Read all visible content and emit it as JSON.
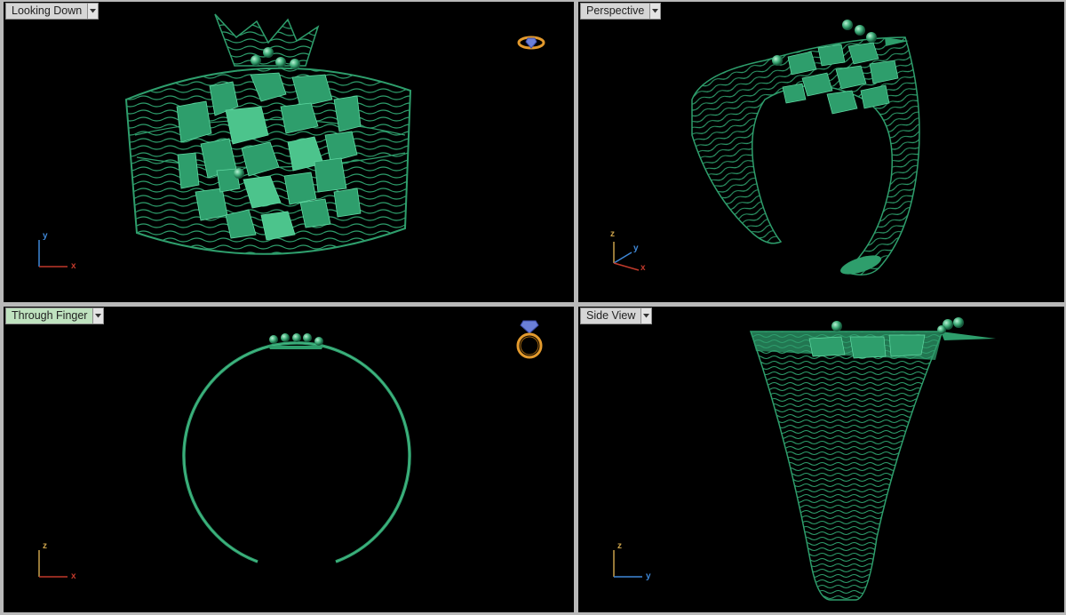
{
  "viewports": [
    {
      "id": "top-left",
      "label": "Looking Down",
      "active": false,
      "axis_v": "y",
      "axis_h": "x"
    },
    {
      "id": "top-right",
      "label": "Perspective",
      "active": false,
      "axis_v": "z",
      "axis_d": "y",
      "axis_h": "x"
    },
    {
      "id": "bottom-left",
      "label": "Through Finger",
      "active": true,
      "axis_v": "z",
      "axis_h": "x"
    },
    {
      "id": "bottom-right",
      "label": "Side View",
      "active": false,
      "axis_v": "z",
      "axis_h": "y"
    }
  ],
  "colors": {
    "model": "#2e9e6c",
    "model_light": "#5fd9a2",
    "model_dark": "#11553a",
    "background": "#000000",
    "axis_x": "#c0392b",
    "axis_y_top": "#3f88d8",
    "axis_z": "#c9a14a",
    "gizmo": "#e39a2d"
  },
  "icons": {
    "ring_top_gizmo": "ring-top-view-icon",
    "ring_front_gizmo": "ring-front-view-icon",
    "dropdown": "chevron-down-icon"
  }
}
